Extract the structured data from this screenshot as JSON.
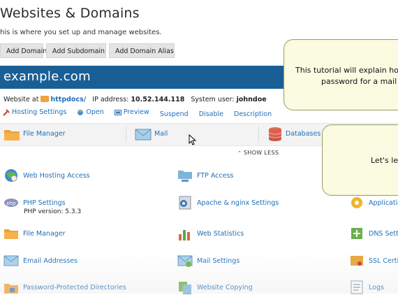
{
  "header": {
    "title": "Websites & Domains",
    "subtitle": "his is where you set up and manage websites."
  },
  "toolbar": {
    "buttons": [
      "Add Domain",
      "Add Subdomain",
      "Add Domain Alias"
    ]
  },
  "domain": {
    "name": "example.com",
    "website_at_label": "Website at",
    "website_folder": "httpdocs/",
    "ip_label": "IP address:",
    "ip_value": "10.52.144.118",
    "system_user_label": "System user:",
    "system_user_value": "johndoe"
  },
  "actions": [
    "Hosting Settings",
    "Open",
    "Preview",
    "Suspend",
    "Disable",
    "Description"
  ],
  "tools": [
    "File Manager",
    "Mail",
    "Databases"
  ],
  "show_less": "SHOW LESS",
  "grid": {
    "col1": [
      "Web Hosting Access",
      "PHP Settings",
      "File Manager",
      "Email Addresses",
      "Password-Protected Directories"
    ],
    "php_version": "PHP version: 5.3.3",
    "col2": [
      "FTP Access",
      "Apache & nginx Settings",
      "Web Statistics",
      "Mail Settings",
      "Website Copying"
    ],
    "col3": [
      "Applicatio",
      "DNS Setti",
      "SSL Certif",
      "Logs"
    ]
  },
  "callouts": {
    "first_line1": "This tutorial will explain ho",
    "first_line2": "password for a mail",
    "second_text": "Let's lea"
  },
  "colors": {
    "domain_bar": "#1a5e96",
    "link": "#1d6fb8",
    "callout_bg": "#fbfbe2"
  }
}
